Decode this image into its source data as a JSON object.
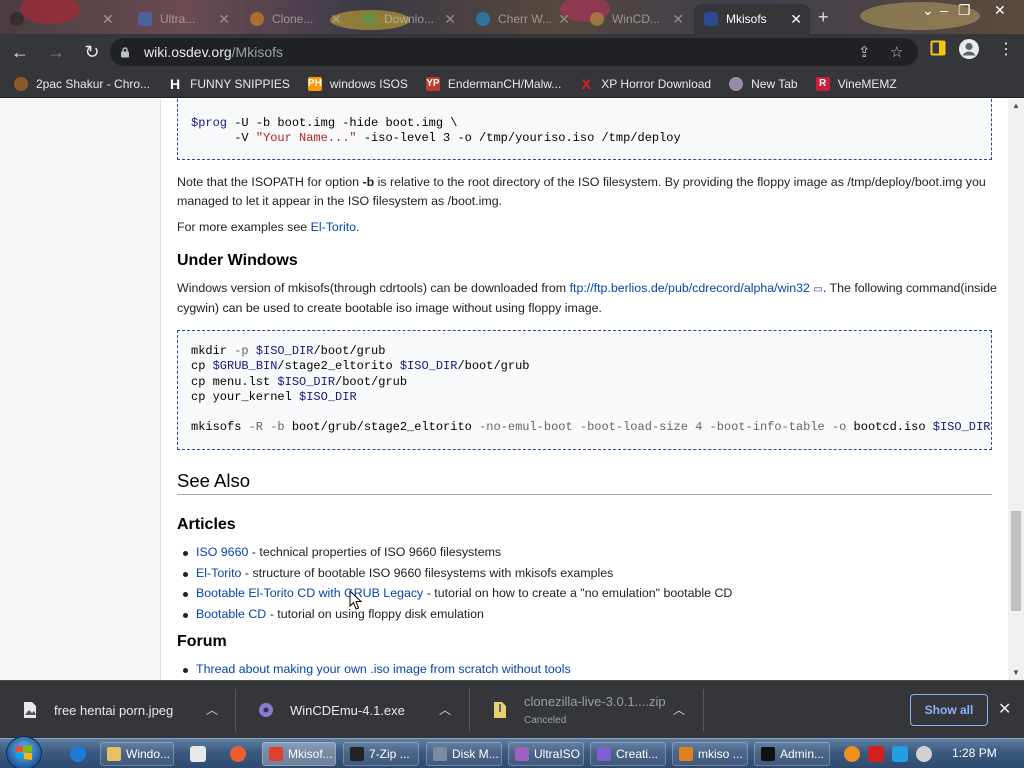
{
  "browser": {
    "tabs": [
      {
        "label": "Ultra...",
        "state": "inactive"
      },
      {
        "label": "Clone...",
        "state": "inactive"
      },
      {
        "label": "Downlo...",
        "state": "inactive"
      },
      {
        "label": "Cherr W...",
        "state": "inactive"
      },
      {
        "label": "WinCD...",
        "state": "inactive"
      },
      {
        "label": "Mkisofs",
        "state": "active"
      }
    ],
    "new_tab": "+",
    "url_host": "wiki.osdev.org",
    "url_path": "/Mkisofs",
    "bookmarks": [
      {
        "label": "2pac Shakur - Chro...",
        "icon": "vinyl-icon",
        "color": "#8b5a2b"
      },
      {
        "label": "FUNNY SNIPPIES",
        "icon": "h-logo-icon",
        "color": "#ffffff",
        "glyph": "H"
      },
      {
        "label": "windows ISOS",
        "icon": "ph-logo-icon",
        "color": "#ff9900",
        "glyph": "PH"
      },
      {
        "label": "EndermanCH/Malw...",
        "icon": "yp-logo-icon",
        "color": "#c0392b",
        "glyph": "YP"
      },
      {
        "label": "XP Horror Download",
        "icon": "x-logo-icon",
        "color": "#e02020",
        "glyph": "X"
      },
      {
        "label": "New Tab",
        "icon": "globe-icon",
        "color": "#9a8ca8"
      },
      {
        "label": "VineMEMZ",
        "icon": "r-logo-icon",
        "color": "#c81e3c",
        "glyph": "R"
      }
    ]
  },
  "page": {
    "code1_lines": [
      [
        {
          "t": "$prog",
          "c": "var"
        },
        {
          "t": " -U -b boot.img -hide boot.img \\"
        }
      ],
      [
        {
          "t": "      -V "
        },
        {
          "t": "\"Your Name...\"",
          "c": "str"
        },
        {
          "t": " -iso-level 3 -o /tmp/youriso.iso /tmp/deploy"
        }
      ]
    ],
    "note_pre": "Note that the ISOPATH for option ",
    "note_bold": "-b",
    "note_post": " is relative to the root directory of the ISO filesystem. By providing the floppy image as /tmp/deploy/boot.img you managed to let it appear in the ISO filesystem as /boot.img.",
    "examples_pre": "For more examples see ",
    "examples_link": "El-Torito",
    "examples_post": ".",
    "windows_heading": "Under Windows",
    "windows_pre": "Windows version of mkisofs(through cdrtools) can be downloaded from ",
    "windows_link": "ftp://ftp.berlios.de/pub/cdrecord/alpha/win32",
    "windows_post": ". The following command(inside cygwin) can be used to create bootable iso image without using floppy image.",
    "code2_lines": [
      [
        {
          "t": "mkdir "
        },
        {
          "t": "-p",
          "c": "op"
        },
        {
          "t": " "
        },
        {
          "t": "$ISO_DIR",
          "c": "var"
        },
        {
          "t": "/boot/grub"
        }
      ],
      [
        {
          "t": "cp "
        },
        {
          "t": "$GRUB_BIN",
          "c": "var"
        },
        {
          "t": "/stage2_eltorito "
        },
        {
          "t": "$ISO_DIR",
          "c": "var"
        },
        {
          "t": "/boot/grub"
        }
      ],
      [
        {
          "t": "cp menu.lst "
        },
        {
          "t": "$ISO_DIR",
          "c": "var"
        },
        {
          "t": "/boot/grub"
        }
      ],
      [
        {
          "t": "cp your_kernel "
        },
        {
          "t": "$ISO_DIR",
          "c": "var"
        }
      ],
      [
        {
          "t": ""
        }
      ],
      [
        {
          "t": "mkisofs "
        },
        {
          "t": "-R",
          "c": "op"
        },
        {
          "t": " "
        },
        {
          "t": "-b",
          "c": "op"
        },
        {
          "t": " boot/grub/stage2_eltorito "
        },
        {
          "t": "-no-emul-boot",
          "c": "op"
        },
        {
          "t": " "
        },
        {
          "t": "-boot-load-size",
          "c": "op"
        },
        {
          "t": " "
        },
        {
          "t": "4",
          "c": "num"
        },
        {
          "t": " "
        },
        {
          "t": "-boot-info-table",
          "c": "op"
        },
        {
          "t": " "
        },
        {
          "t": "-o",
          "c": "op"
        },
        {
          "t": " bootcd.iso "
        },
        {
          "t": "$ISO_DIR",
          "c": "var"
        }
      ]
    ],
    "see_also_heading": "See Also",
    "articles_heading": "Articles",
    "articles": [
      {
        "link": "ISO 9660",
        "text": " - technical properties of ISO 9660 filesystems"
      },
      {
        "link": "El-Torito",
        "text": " - structure of bootable ISO 9660 filesystems with mkisofs examples"
      },
      {
        "link": "Bootable El-Torito CD with GRUB Legacy",
        "text": " - tutorial on how to create a \"no emulation\" bootable CD"
      },
      {
        "link": "Bootable CD",
        "text": " - tutorial on using floppy disk emulation"
      }
    ],
    "forum_heading": "Forum",
    "forum_items": [
      {
        "link": "Thread about making your own .iso image from scratch without tools",
        "text": ""
      }
    ]
  },
  "downloads": {
    "items": [
      {
        "name": "free hentai porn.jpeg",
        "status": ""
      },
      {
        "name": "WinCDEmu-4.1.exe",
        "status": ""
      },
      {
        "name": "clonezilla-live-3.0.1....zip",
        "status": "Canceled"
      }
    ],
    "show_all": "Show all"
  },
  "taskbar": {
    "buttons": [
      {
        "label": "Windo...",
        "icon": "folder-icon",
        "color": "#e8c060"
      },
      {
        "label": "Mkisof...",
        "icon": "chrome-icon",
        "color": "#e04030",
        "active": true
      },
      {
        "label": "7-Zip ...",
        "icon": "7zip-icon",
        "color": "#222222"
      },
      {
        "label": "Disk M...",
        "icon": "disk-management-icon",
        "color": "#7a8ca0"
      },
      {
        "label": "UltraISO",
        "icon": "ultraiso-icon",
        "color": "#a060c0"
      },
      {
        "label": "Creati...",
        "icon": "creation-icon",
        "color": "#8060d0"
      },
      {
        "label": "mkiso ...",
        "icon": "search-icon",
        "color": "#e08020"
      },
      {
        "label": "Admin...",
        "icon": "cmd-icon",
        "color": "#111111"
      }
    ],
    "clock": "1:28 PM"
  }
}
